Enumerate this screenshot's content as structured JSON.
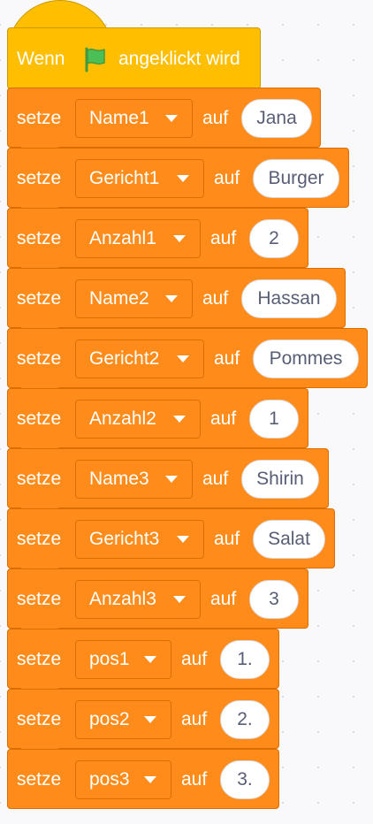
{
  "event": {
    "label_before": "Wenn",
    "icon": "green-flag-icon",
    "label_after": "angeklickt wird",
    "color": "#ffbf00",
    "flag_color": "#4cbf56"
  },
  "set_word": "setze",
  "to_word": "auf",
  "block_color": "#ff8c1a",
  "blocks": [
    {
      "variable": "Name1",
      "value": "Jana"
    },
    {
      "variable": "Gericht1",
      "value": "Burger"
    },
    {
      "variable": "Anzahl1",
      "value": "2"
    },
    {
      "variable": "Name2",
      "value": "Hassan"
    },
    {
      "variable": "Gericht2",
      "value": "Pommes"
    },
    {
      "variable": "Anzahl2",
      "value": "1"
    },
    {
      "variable": "Name3",
      "value": "Shirin"
    },
    {
      "variable": "Gericht3",
      "value": "Salat"
    },
    {
      "variable": "Anzahl3",
      "value": "3"
    },
    {
      "variable": "pos1",
      "value": "1."
    },
    {
      "variable": "pos2",
      "value": "2."
    },
    {
      "variable": "pos3",
      "value": "3."
    }
  ]
}
